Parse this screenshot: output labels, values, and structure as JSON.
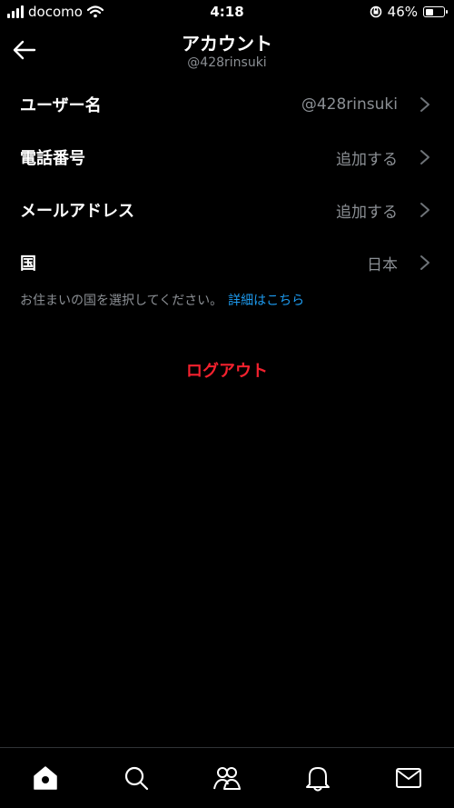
{
  "status_bar": {
    "carrier": "docomo",
    "time": "4:18",
    "battery_percent": "46%",
    "battery_level": 0.46
  },
  "header": {
    "title": "アカウント",
    "subtitle": "@428rinsuki"
  },
  "rows": [
    {
      "label": "ユーザー名",
      "value": "@428rinsuki"
    },
    {
      "label": "電話番号",
      "value": "追加する"
    },
    {
      "label": "メールアドレス",
      "value": "追加する"
    },
    {
      "label": "国",
      "value": "日本"
    }
  ],
  "helper": {
    "text": "お住まいの国を選択してください。",
    "link": "詳細はこちら"
  },
  "logout_label": "ログアウト",
  "tabs": [
    {
      "icon": "home-icon"
    },
    {
      "icon": "search-icon"
    },
    {
      "icon": "communities-icon"
    },
    {
      "icon": "notifications-icon"
    },
    {
      "icon": "messages-icon"
    }
  ],
  "colors": {
    "background": "#000000",
    "secondary_text": "#8b8f94",
    "link": "#1d9bf0",
    "danger": "#f4212e"
  }
}
